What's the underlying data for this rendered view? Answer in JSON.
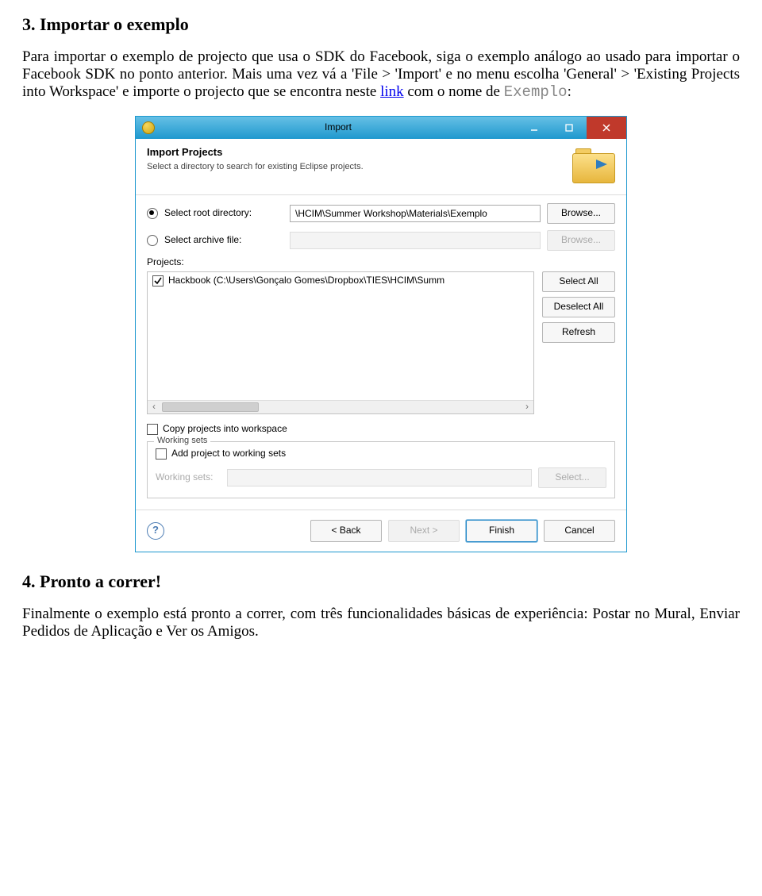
{
  "section3": {
    "heading": "3. Importar o exemplo",
    "para_lead": "Para importar o exemplo de projecto que usa o SDK do Facebook, siga o exemplo análogo ao usado para importar o Facebook SDK no ponto anterior. Mais uma vez vá a 'File > 'Import' e no menu escolha 'General' > 'Existing Projects into Workspace' e importe o projecto que se encontra neste ",
    "link_label": "link",
    "para_tail_a": " com o nome de ",
    "mono_text": "Exemplo",
    "para_tail_b": ":"
  },
  "dialog": {
    "title": "Import",
    "header_title": "Import Projects",
    "header_sub": "Select a directory to search for existing Eclipse projects.",
    "root_label": "Select root directory:",
    "root_value": "\\HCIM\\Summer Workshop\\Materials\\Exemplo",
    "archive_label": "Select archive file:",
    "browse": "Browse...",
    "projects_label": "Projects:",
    "project_item": "Hackbook (C:\\Users\\Gonçalo Gomes\\Dropbox\\TIES\\HCIM\\Summ",
    "select_all": "Select All",
    "deselect_all": "Deselect All",
    "refresh": "Refresh",
    "copy_label": "Copy projects into workspace",
    "ws_legend": "Working sets",
    "ws_add_label": "Add project to working sets",
    "ws_sets_label": "Working sets:",
    "ws_select": "Select...",
    "back": "< Back",
    "next": "Next >",
    "finish": "Finish",
    "cancel": "Cancel"
  },
  "section4": {
    "heading": "4. Pronto a correr!",
    "para": "Finalmente o exemplo está pronto a correr, com três funcionalidades básicas de experiência: Postar no Mural, Enviar Pedidos de Aplicação e Ver os Amigos."
  }
}
